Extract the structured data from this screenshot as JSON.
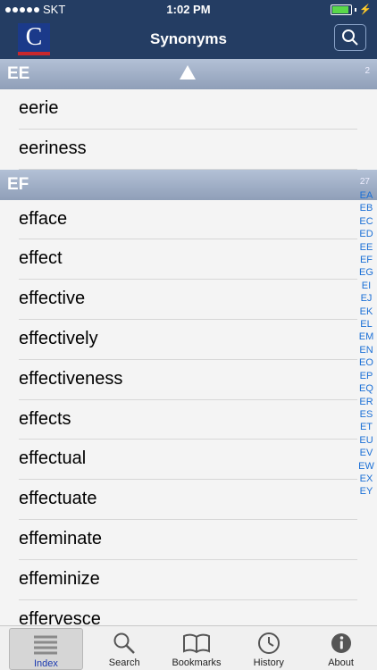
{
  "status": {
    "carrier": "SKT",
    "time": "1:02 PM"
  },
  "nav": {
    "title": "Synonyms",
    "logo_letter": "C"
  },
  "sections": [
    {
      "letter": "EE",
      "count": "2",
      "words": [
        "eerie",
        "eeriness"
      ]
    },
    {
      "letter": "EF",
      "count": "27",
      "words": [
        "efface",
        "effect",
        "effective",
        "effectively",
        "effectiveness",
        "effects",
        "effectual",
        "effectuate",
        "effeminate",
        "effeminize",
        "effervesce"
      ]
    }
  ],
  "index_letters": [
    "EA",
    "EB",
    "EC",
    "ED",
    "EE",
    "EF",
    "EG",
    "EI",
    "EJ",
    "EK",
    "EL",
    "EM",
    "EN",
    "EO",
    "EP",
    "EQ",
    "ER",
    "ES",
    "ET",
    "EU",
    "EV",
    "EW",
    "EX",
    "EY"
  ],
  "tabs": [
    {
      "label": "Index",
      "icon": "list-icon",
      "selected": true
    },
    {
      "label": "Search",
      "icon": "magnifier-icon"
    },
    {
      "label": "Bookmarks",
      "icon": "book-icon"
    },
    {
      "label": "History",
      "icon": "clock-icon"
    },
    {
      "label": "About",
      "icon": "info-icon"
    }
  ],
  "colors": {
    "navbar": "#243d63",
    "accent": "#1a6fd6",
    "section_header": "#9aaac2"
  }
}
